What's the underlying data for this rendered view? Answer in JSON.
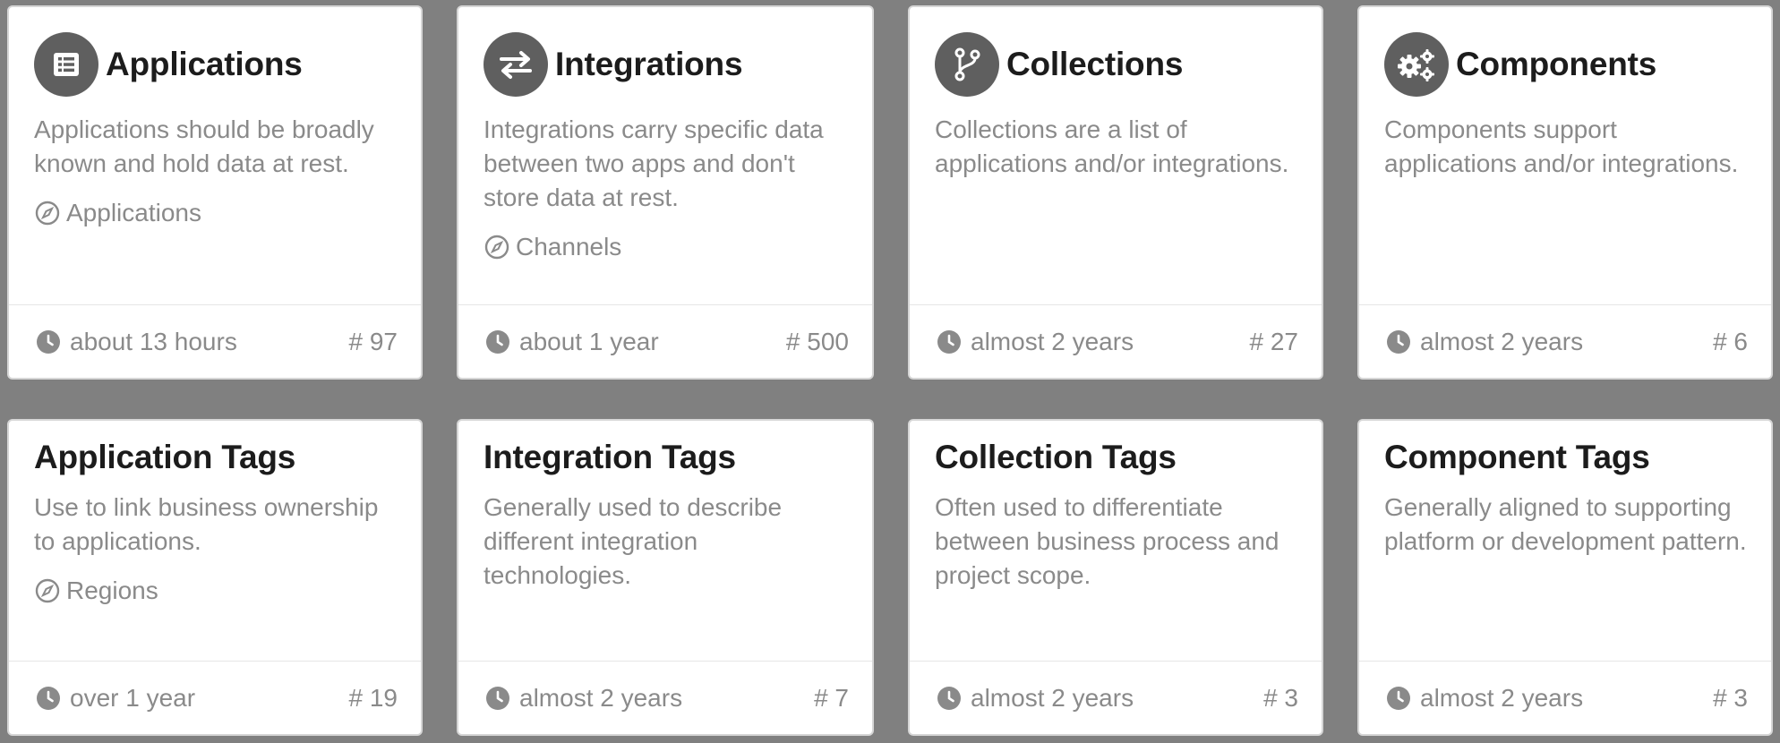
{
  "cards": [
    {
      "title": "Applications",
      "icon": "list-icon",
      "description": "Applications should be broadly known and hold data at rest.",
      "link": "Applications",
      "time": "about 13 hours",
      "count": "# 97"
    },
    {
      "title": "Integrations",
      "icon": "swap-arrows-icon",
      "description": "Integrations carry specific data between two apps and don't store data at rest.",
      "link": "Channels",
      "time": "about 1 year",
      "count": "# 500"
    },
    {
      "title": "Collections",
      "icon": "branch-icon",
      "description": "Collections are a list of applications and/or integrations.",
      "time": "almost 2 years",
      "count": "# 27"
    },
    {
      "title": "Components",
      "icon": "gears-icon",
      "description": "Components support applications and/or integrations.",
      "time": "almost 2 years",
      "count": "# 6"
    },
    {
      "title": "Application Tags",
      "description": "Use to link business ownership to applications.",
      "link": "Regions",
      "time": "over 1 year",
      "count": "# 19"
    },
    {
      "title": "Integration Tags",
      "description": "Generally used to describe different integration technologies.",
      "time": "almost 2 years",
      "count": "# 7"
    },
    {
      "title": "Collection Tags",
      "description": "Often used to differentiate between business process and project scope.",
      "time": "almost 2 years",
      "count": "# 3"
    },
    {
      "title": "Component Tags",
      "description": "Generally aligned to supporting platform or development pattern.",
      "time": "almost 2 years",
      "count": "# 3"
    }
  ],
  "colors": {
    "background": "#808080",
    "icon_circle": "#5f5f5f",
    "title": "#1c1c1c",
    "muted": "#8a8a8a"
  }
}
